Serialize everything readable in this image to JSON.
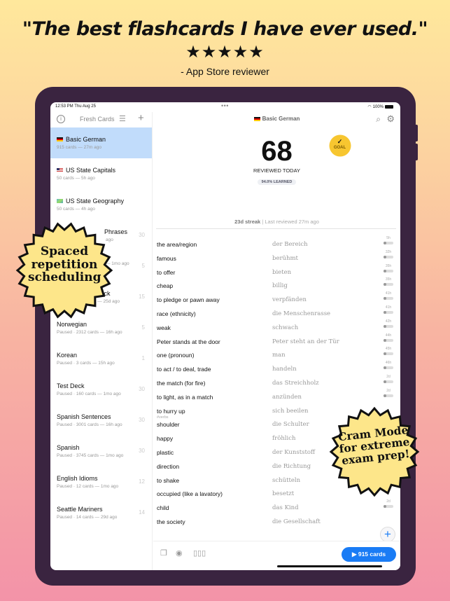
{
  "promo": {
    "headline": "\"The best flashcards I have ever used.\"",
    "stars": "★★★★★",
    "rating": 5,
    "attribution": "- App Store reviewer"
  },
  "status_bar": {
    "time": "12:53 PM  Thu Aug 25",
    "dots": "•••",
    "battery": "100%"
  },
  "sidebar": {
    "title": "Fresh Cards",
    "info_icon": "info-icon",
    "list_icon": "list-icon",
    "add_icon": "plus-icon",
    "decks": [
      {
        "name": "Basic German",
        "meta": "915 cards — 27m ago",
        "count": "",
        "flag": "de",
        "selected": true
      },
      {
        "name": "US State Capitals",
        "meta": "50 cards — 5h ago",
        "count": "",
        "flag": "us"
      },
      {
        "name": "US State Geography",
        "meta": "50 cards — 4h ago",
        "count": "",
        "flag": "map"
      },
      {
        "name": "Phrases",
        "meta": "ago",
        "count": "30",
        "flag": ""
      },
      {
        "name": "",
        "meta": "— 1mo ago",
        "count": "5",
        "flag": ""
      },
      {
        "name": "Custom Kanji Deck",
        "meta": "Paused · 231 cards — 25d ago",
        "count": "15"
      },
      {
        "name": "Norwegian",
        "meta": "Paused · 2312 cards — 16h ago",
        "count": "5"
      },
      {
        "name": "Korean",
        "meta": "Paused · 3 cards — 15h ago",
        "count": "1"
      },
      {
        "name": "Test Deck",
        "meta": "Paused · 160 cards — 1mo ago",
        "count": "30"
      },
      {
        "name": "Spanish Sentences",
        "meta": "Paused · 3001 cards — 16h ago",
        "count": "30"
      },
      {
        "name": "Spanish",
        "meta": "Paused · 3745 cards — 1mo ago",
        "count": "30"
      },
      {
        "name": "English Idioms",
        "meta": "Paused · 12 cards — 1mo ago",
        "count": "12"
      },
      {
        "name": "Seattle Mariners",
        "meta": "Paused · 14 cards — 29d ago",
        "count": "14"
      }
    ]
  },
  "main": {
    "title": "Basic German",
    "reviewed_count": "68",
    "goal_label": "GOAL",
    "goal_check": "✓",
    "reviewed_label": "REVIEWED TODAY",
    "learned_label": "94.0% LEARNED",
    "streak": "23d streak",
    "last_reviewed": " | Last reviewed 27m ago",
    "cards": [
      {
        "front": "the area/region",
        "back": "der Bereich",
        "due": "5h"
      },
      {
        "front": "famous",
        "back": "berühmt",
        "due": "32h"
      },
      {
        "front": "to offer",
        "back": "bieten",
        "due": "35h"
      },
      {
        "front": "cheap",
        "back": "billig",
        "due": "35h"
      },
      {
        "front": "to pledge or pawn away",
        "back": "verpfänden",
        "due": "41h"
      },
      {
        "front": "race (ethnicity)",
        "back": "die Menschenrasse",
        "due": "41h"
      },
      {
        "front": "weak",
        "back": "schwach",
        "due": "42h"
      },
      {
        "front": "Peter stands at the door",
        "back": "Peter steht an der Tür",
        "due": "44h"
      },
      {
        "front": "one (pronoun)",
        "back": "man",
        "due": "45h"
      },
      {
        "front": "to act / to deal, trade",
        "back": "handeln",
        "due": "46h"
      },
      {
        "front": "the match (for fire)",
        "back": "das Streichholz",
        "due": "2d"
      },
      {
        "front": "to light, as in a match",
        "back": "anzünden",
        "due": "2d"
      },
      {
        "front": "to hurry up",
        "back": "sich beeilen",
        "due": "",
        "tag": "#verbs"
      },
      {
        "front": "shoulder",
        "back": "die Schulter",
        "due": ""
      },
      {
        "front": "happy",
        "back": "fröhlich",
        "due": ""
      },
      {
        "front": "plastic",
        "back": "der Kunststoff",
        "due": ""
      },
      {
        "front": "direction",
        "back": "die Richtung",
        "due": ""
      },
      {
        "front": "to shake",
        "back": "schütteln",
        "due": ""
      },
      {
        "front": "occupied (like a lavatory)",
        "back": "besetzt",
        "due": ""
      },
      {
        "front": "child",
        "back": "das Kind",
        "due": "2d"
      },
      {
        "front": "the society",
        "back": "die Gesellschaft",
        "due": ""
      }
    ],
    "fab_label": "+",
    "play_button": "▶ 915 cards"
  },
  "badges": {
    "left": "Spaced repetition scheduling",
    "right": "Cram Mode for extreme exam prep!",
    "color": "#fde68a"
  }
}
